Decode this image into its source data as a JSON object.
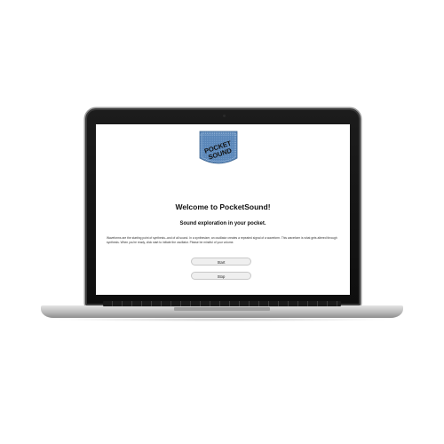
{
  "app": {
    "logo_text_line1": "POCKET",
    "logo_text_line2": "SOUND"
  },
  "main": {
    "title": "Welcome to PocketSound!",
    "subtitle": "Sound exploration in your pocket.",
    "description": "Waveforms are the starting point of synthesis--and of all sound. In a synthesizer, an oscillator creates a repeated signal of a waveform. This waveform is what gets altered through synthesis. When you're ready, click start to initiate the oscillator. Please be mindful of your volume.",
    "start_label": "Start",
    "stop_label": "Stop"
  },
  "colors": {
    "denim": "#5a86b8",
    "button_bg": "#efefef",
    "bezel": "#141414"
  }
}
